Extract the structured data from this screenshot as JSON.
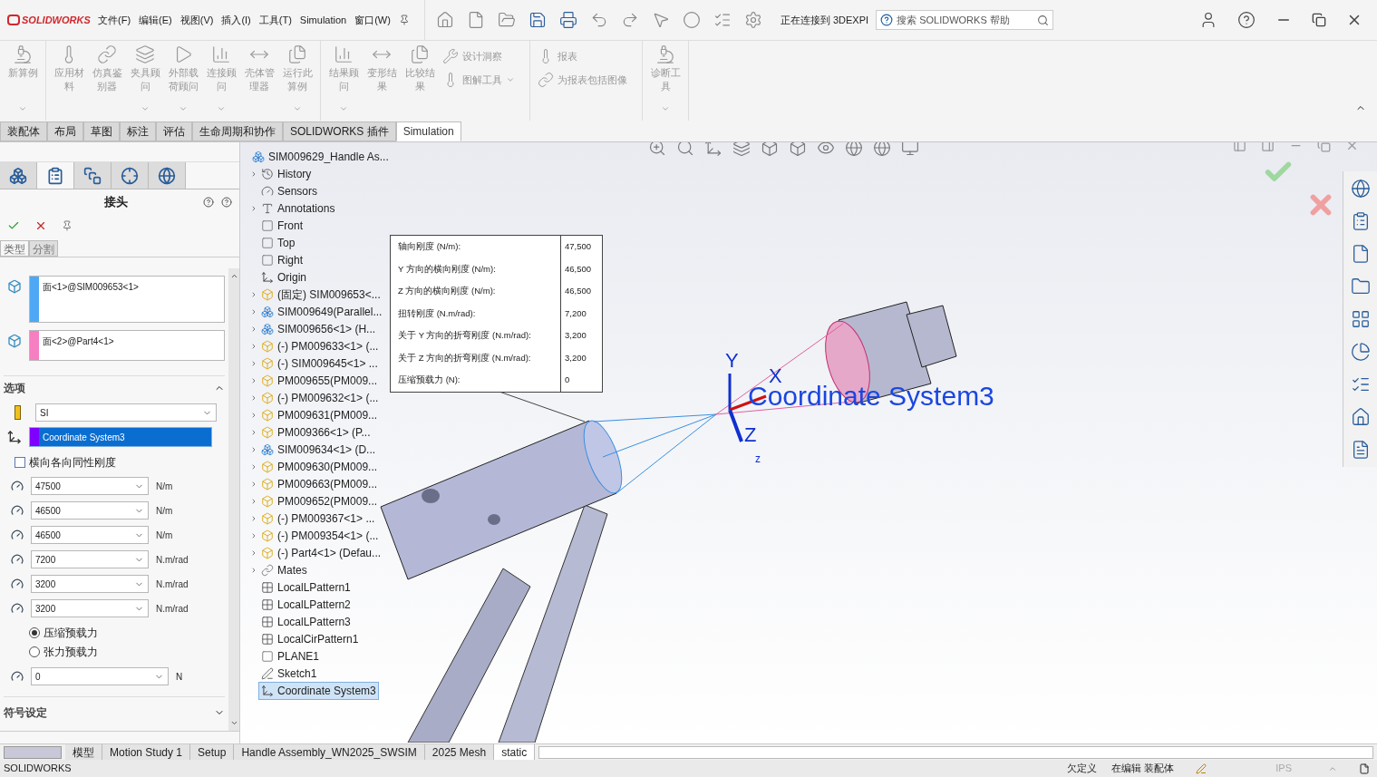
{
  "app": {
    "logo": "SOLIDWORKS",
    "menus": [
      "文件(F)",
      "编辑(E)",
      "视图(V)",
      "插入(I)",
      "工具(T)",
      "Simulation",
      "窗口(W)"
    ],
    "connection": "正在连接到 3DEXPI",
    "search": {
      "placeholder": "搜索 SOLIDWORKS 帮助"
    }
  },
  "ribbon": [
    {
      "items": [
        {
          "label": "新算例",
          "kind": "large",
          "disabled": true,
          "dropdown": true
        }
      ]
    },
    {
      "items": [
        {
          "label": "应用材料",
          "kind": "large",
          "disabled": true,
          "dropdown": false
        },
        {
          "label": "仿真鉴别器",
          "kind": "large",
          "disabled": true,
          "dropdown": false
        },
        {
          "label": "夹具顾问",
          "kind": "large",
          "disabled": true,
          "dropdown": true
        },
        {
          "label": "外部载荷顾问",
          "kind": "large",
          "disabled": true,
          "dropdown": true
        },
        {
          "label": "连接顾问",
          "kind": "large",
          "disabled": true,
          "dropdown": true
        },
        {
          "label": "壳体管理器",
          "kind": "large",
          "disabled": true,
          "dropdown": false
        },
        {
          "label": "运行此算例",
          "kind": "large",
          "disabled": true,
          "dropdown": true
        }
      ]
    },
    {
      "items": [
        {
          "label": "结果顾问",
          "kind": "large",
          "disabled": true,
          "dropdown": true
        },
        {
          "label": "变形结果",
          "kind": "large",
          "disabled": true,
          "dropdown": false
        },
        {
          "label": "比较结果",
          "kind": "large",
          "disabled": true,
          "dropdown": false
        },
        {
          "label": "设计洞察",
          "kind": "small",
          "disabled": true,
          "dropdown": false
        },
        {
          "label": "图解工具",
          "kind": "small",
          "disabled": true,
          "dropdown": true
        }
      ]
    },
    {
      "items": [
        {
          "label": "报表",
          "kind": "small",
          "disabled": true,
          "dropdown": false
        },
        {
          "label": "为报表包括图像",
          "kind": "small",
          "disabled": true,
          "dropdown": false
        }
      ]
    },
    {
      "items": [
        {
          "label": "诊断工具",
          "kind": "large",
          "disabled": true,
          "dropdown": true
        }
      ]
    }
  ],
  "command_tabs": [
    {
      "label": "装配体",
      "selected": false
    },
    {
      "label": "布局",
      "selected": false
    },
    {
      "label": "草图",
      "selected": false
    },
    {
      "label": "标注",
      "selected": false
    },
    {
      "label": "评估",
      "selected": false
    },
    {
      "label": "生命周期和协作",
      "selected": false
    },
    {
      "label": "SOLIDWORKS 插件",
      "selected": false
    },
    {
      "label": "Simulation",
      "selected": true
    }
  ],
  "property_manager": {
    "panel_tabs": [
      {
        "kind": "tree",
        "selected": false
      },
      {
        "kind": "property",
        "selected": true
      },
      {
        "kind": "config",
        "selected": false
      },
      {
        "kind": "dimxpert",
        "selected": false
      },
      {
        "kind": "display",
        "selected": false
      }
    ],
    "title": "接头",
    "sub_tabs": [
      {
        "label": "类型",
        "selected": true
      },
      {
        "label": "分割",
        "selected": false
      }
    ],
    "selection_boxes": [
      {
        "text": "面<1>@SIM009653<1>",
        "color": "#4fa8f5"
      },
      {
        "text": "面<2>@Part4<1>",
        "color": "#f57fc0"
      }
    ],
    "options": {
      "title": "选项",
      "expanded": true,
      "unit": "SI",
      "coordinate": {
        "value": "Coordinate System3",
        "color": "#8000ff"
      },
      "isotropic": {
        "label": "横向各向同性刚度",
        "checked": false
      },
      "stiffness": [
        {
          "value": "47500",
          "unit": "N/m"
        },
        {
          "value": "46500",
          "unit": "N/m"
        },
        {
          "value": "46500",
          "unit": "N/m"
        },
        {
          "value": "7200",
          "unit": "N.m/rad"
        },
        {
          "value": "3200",
          "unit": "N.m/rad"
        },
        {
          "value": "3200",
          "unit": "N.m/rad"
        }
      ],
      "preload_types": [
        {
          "label": "压缩预载力",
          "selected": true
        },
        {
          "label": "张力预载力",
          "selected": false
        }
      ],
      "preload": {
        "value": "0",
        "unit": "N"
      }
    },
    "symbol_settings": {
      "title": "符号设定",
      "expanded": false
    }
  },
  "feature_tree": {
    "label": "SIM009629_Handle As...",
    "kind": "assembly",
    "collapsed": false,
    "selected": false,
    "children": [
      {
        "label": "History",
        "kind": "history",
        "collapsed": true,
        "selected": false
      },
      {
        "label": "Sensors",
        "kind": "sensor",
        "collapsed": false,
        "selected": false
      },
      {
        "label": "Annotations",
        "kind": "annotation",
        "collapsed": true,
        "selected": false
      },
      {
        "label": "Front",
        "kind": "plane",
        "collapsed": false,
        "selected": false
      },
      {
        "label": "Top",
        "kind": "plane",
        "collapsed": false,
        "selected": false
      },
      {
        "label": "Right",
        "kind": "plane",
        "collapsed": false,
        "selected": false
      },
      {
        "label": "Origin",
        "kind": "origin",
        "collapsed": false,
        "selected": false
      },
      {
        "label": "(固定) SIM009653<...",
        "kind": "part",
        "collapsed": true,
        "selected": false
      },
      {
        "label": "SIM009649(Parallel...",
        "kind": "assembly",
        "collapsed": true,
        "selected": false
      },
      {
        "label": "SIM009656<1> (H...",
        "kind": "assembly",
        "collapsed": true,
        "selected": false
      },
      {
        "label": "(-) PM009633<1> (...",
        "kind": "part",
        "collapsed": true,
        "selected": false
      },
      {
        "label": "(-) SIM009645<1> ...",
        "kind": "part",
        "collapsed": true,
        "selected": false
      },
      {
        "label": "PM009655(PM009...",
        "kind": "part",
        "collapsed": true,
        "selected": false
      },
      {
        "label": "(-) PM009632<1> (...",
        "kind": "part",
        "collapsed": true,
        "selected": false
      },
      {
        "label": "PM009631(PM009...",
        "kind": "part",
        "collapsed": true,
        "selected": false
      },
      {
        "label": "PM009366<1> (P...",
        "kind": "part",
        "collapsed": true,
        "selected": false
      },
      {
        "label": "SIM009634<1> (D...",
        "kind": "assembly",
        "collapsed": true,
        "selected": false
      },
      {
        "label": "PM009630(PM009...",
        "kind": "part",
        "collapsed": true,
        "selected": false
      },
      {
        "label": "PM009663(PM009...",
        "kind": "part",
        "collapsed": true,
        "selected": false
      },
      {
        "label": "PM009652(PM009...",
        "kind": "part",
        "collapsed": true,
        "selected": false
      },
      {
        "label": "(-) PM009367<1> ...",
        "kind": "part",
        "collapsed": true,
        "selected": false
      },
      {
        "label": "(-) PM009354<1> (...",
        "kind": "part",
        "collapsed": true,
        "selected": false
      },
      {
        "label": "(-) Part4<1> (Defau...",
        "kind": "part",
        "collapsed": true,
        "selected": false
      },
      {
        "label": "Mates",
        "kind": "mates",
        "collapsed": true,
        "selected": false
      },
      {
        "label": "LocalLPattern1",
        "kind": "pattern",
        "collapsed": false,
        "selected": false
      },
      {
        "label": "LocalLPattern2",
        "kind": "pattern",
        "collapsed": false,
        "selected": false
      },
      {
        "label": "LocalLPattern3",
        "kind": "pattern",
        "collapsed": false,
        "selected": false
      },
      {
        "label": "LocalCirPattern1",
        "kind": "pattern",
        "collapsed": false,
        "selected": false
      },
      {
        "label": "PLANE1",
        "kind": "plane",
        "collapsed": false,
        "selected": false
      },
      {
        "label": "Sketch1",
        "kind": "sketch",
        "collapsed": false,
        "selected": false
      },
      {
        "label": "Coordinate System3",
        "kind": "coordinate",
        "collapsed": false,
        "selected": true
      }
    ]
  },
  "stiffness_tooltip": [
    {
      "label": "轴向刚度 (N/m):",
      "value": "47,500"
    },
    {
      "label": "Y 方向的横向刚度 (N/m):",
      "value": "46,500"
    },
    {
      "label": "Z 方向的横向刚度 (N/m):",
      "value": "46,500"
    },
    {
      "label": "扭转刚度 (N.m/rad):",
      "value": "7,200"
    },
    {
      "label": "关于 Y 方向的折弯刚度 (N.m/rad):",
      "value": "3,200"
    },
    {
      "label": "关于 Z 方向的折弯刚度 (N.m/rad):",
      "value": "3,200"
    },
    {
      "label": "压缩预载力 (N):",
      "value": "0"
    }
  ],
  "viewport": {
    "coordinate_label": "Coordinate System3",
    "axis_labels": [
      "Y",
      "X",
      "Z",
      "z"
    ]
  },
  "bottom_tabs": [
    {
      "label": "模型",
      "selected": false
    },
    {
      "label": "Motion Study 1",
      "selected": false
    },
    {
      "label": "Setup",
      "selected": false
    },
    {
      "label": "Handle Assembly_WN2025_SWSIM",
      "selected": false
    },
    {
      "label": "2025 Mesh",
      "selected": false
    },
    {
      "label": "static",
      "selected": true
    }
  ],
  "status_bar": {
    "app": "SOLIDWORKS",
    "definition": "欠定义",
    "mode": "在编辑 装配体",
    "units": "IPS"
  }
}
